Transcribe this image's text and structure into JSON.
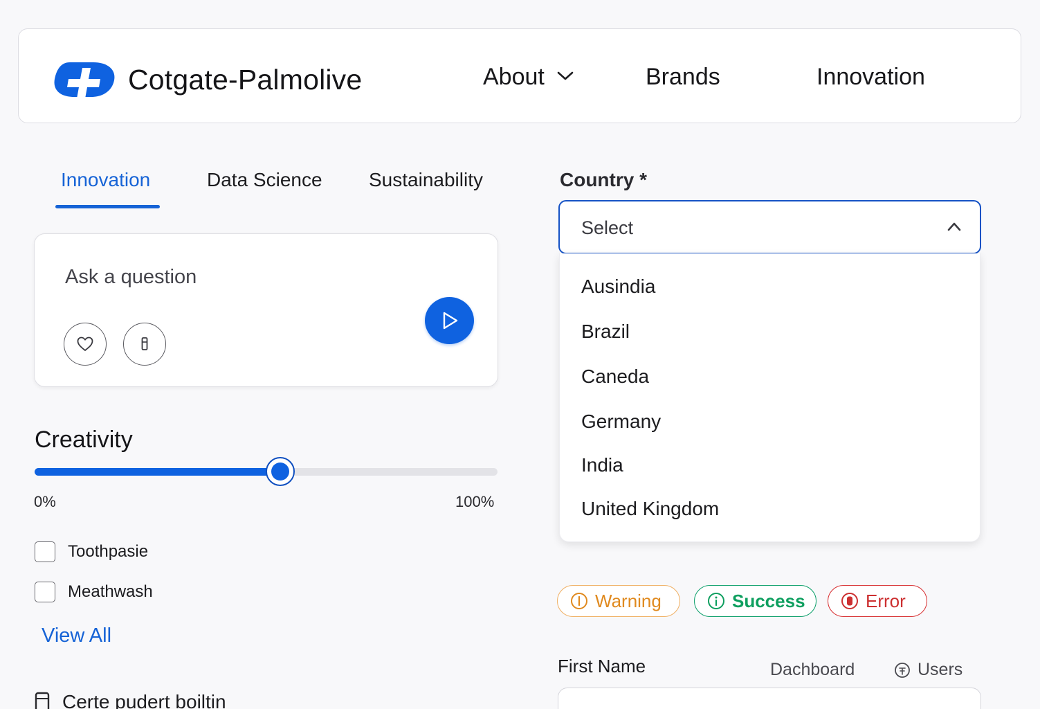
{
  "header": {
    "brand_name": "Cotgate-Palmolive",
    "logo_icon": "brand-logo-icon",
    "accent_color": "#0f62e0",
    "nav": {
      "about": "About",
      "brands": "Brands",
      "innovation": "Innovation"
    }
  },
  "tabs": {
    "active": "Innovation",
    "items": [
      "Innovation",
      "Data Science",
      "Sustainability"
    ]
  },
  "ask": {
    "placeholder": "Ask a question",
    "icons": [
      "heart-icon",
      "microphone-icon",
      "play-icon"
    ]
  },
  "creativity": {
    "title": "Creativity",
    "min_label": "0%",
    "max_label": "100%",
    "value_fraction": 0.53
  },
  "filters": [
    {
      "label": "Toothpasie",
      "checked": false
    },
    {
      "label": "Meathwash",
      "checked": false
    }
  ],
  "view_all": "View All",
  "bottom_item": {
    "label": "Certe pudert boiltin",
    "icon": "device-icon"
  },
  "country": {
    "label": "Country *",
    "selected": "Select",
    "open": true,
    "options": [
      "Ausindia",
      "Brazil",
      "Caneda",
      "Germany",
      "India",
      "United Kingdom"
    ]
  },
  "badges": {
    "warning": {
      "label": "Warning",
      "color": "#e08a1f"
    },
    "success": {
      "label": "Success",
      "color": "#0e9f5f"
    },
    "error": {
      "label": "Error",
      "color": "#cc2f30"
    }
  },
  "form": {
    "first_name_label": "First Name",
    "first_name_placeholder": ""
  },
  "mini_nav": {
    "dashboard": "Dachboard",
    "users": "Users"
  }
}
